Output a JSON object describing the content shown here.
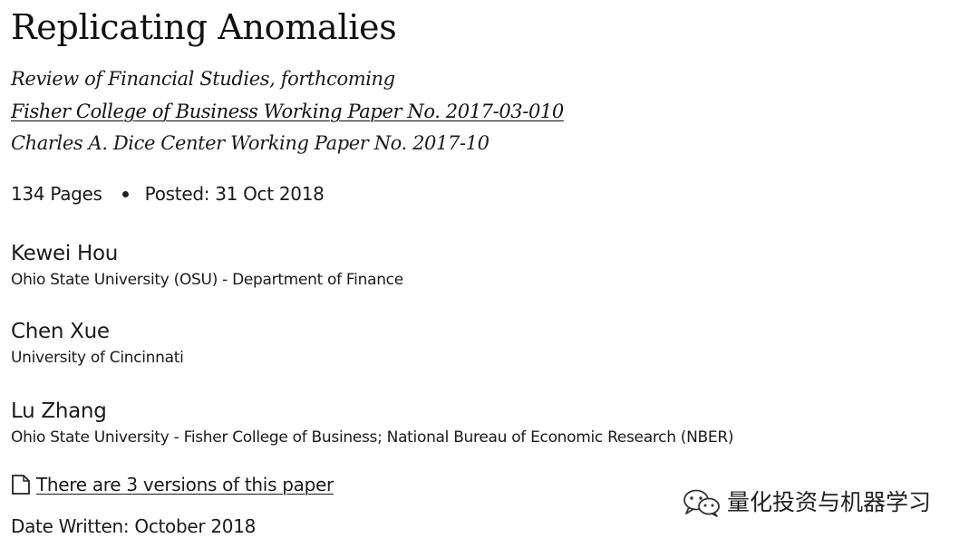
{
  "paper": {
    "title": "Replicating Anomalies",
    "publications": [
      {
        "text": "Review of Financial Studies, forthcoming",
        "is_link": false
      },
      {
        "text": "Fisher College of Business Working Paper No. 2017-03-010",
        "is_link": true
      },
      {
        "text": "Charles A. Dice Center Working Paper No. 2017-10",
        "is_link": false
      }
    ],
    "pages": "134 Pages",
    "posted": "Posted: 31 Oct 2018"
  },
  "authors": [
    {
      "name": "Kewei Hou",
      "affiliation": "Ohio State University (OSU) - Department of Finance"
    },
    {
      "name": "Chen Xue",
      "affiliation": "University of Cincinnati"
    },
    {
      "name": "Lu Zhang",
      "affiliation": "Ohio State University - Fisher College of Business; National Bureau of Economic Research (NBER)"
    }
  ],
  "versions": {
    "icon": "document-icon",
    "label": "There are 3 versions of this paper"
  },
  "date_written": "Date Written: October 2018",
  "watermark": {
    "icon": "wechat-icon",
    "text": "量化投资与机器学习"
  }
}
